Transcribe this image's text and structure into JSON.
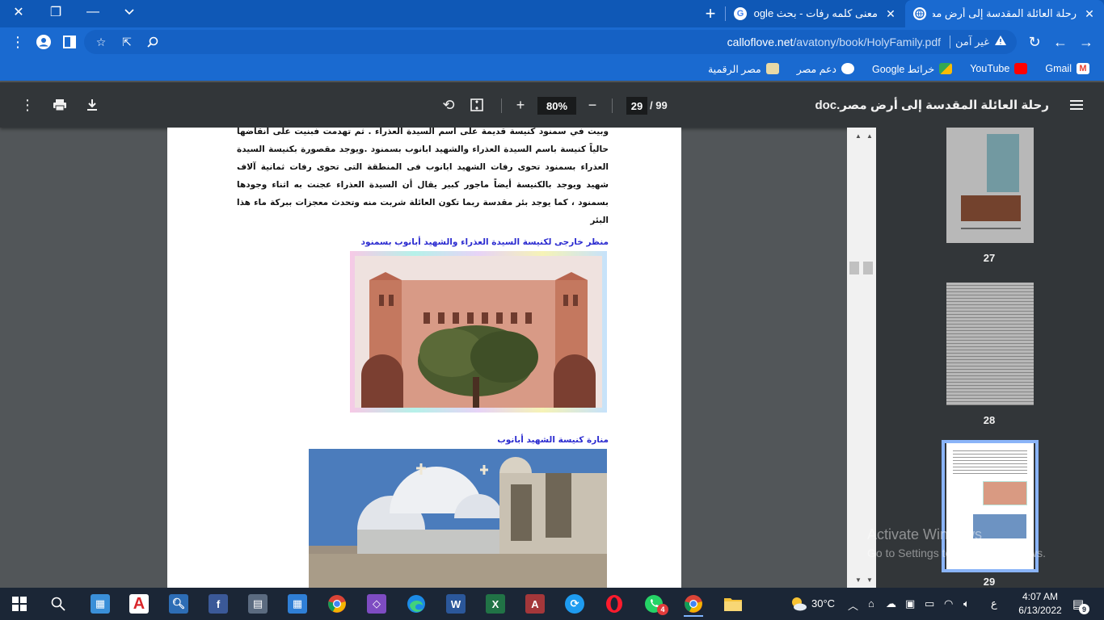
{
  "browser": {
    "tabs": [
      {
        "title": "رحلة العائلة المقدسة إلى أرض مصر",
        "favicon": "globe-icon",
        "active": true
      },
      {
        "title": "معنى كلمه رفات - بحث Google",
        "favicon": "google-icon",
        "active": false
      }
    ],
    "new_tab_label": "+",
    "address": {
      "insecure_label": "غير آمن",
      "domain": "calloflove.net",
      "path": "/avatony/book/HolyFamily.pdf"
    },
    "bookmarks": [
      {
        "label": "Gmail",
        "icon": "gmail-icon",
        "color": "#ea4335"
      },
      {
        "label": "YouTube",
        "icon": "youtube-icon",
        "color": "#ff0000"
      },
      {
        "label": "خرائط Google",
        "icon": "maps-icon",
        "color": "#34a853"
      },
      {
        "label": "دعم مصر",
        "icon": "globe-icon",
        "color": "#ffffff"
      },
      {
        "label": "مصر الرقمية",
        "icon": "digital-egypt-icon",
        "color": "#e8d9a6"
      }
    ]
  },
  "pdf": {
    "doc_title": "رحلة العائلة المقدسة إلى أرض مصر.doc",
    "current_page": "29",
    "total_pages": "/ 99",
    "zoom": "80%",
    "paragraph": "وبيت في سمنود كنيسة قديمة على اسم السيدة العذراء . ثم تهدمت فبنيت على أنقاضها حالياً كنيسة باسم السيدة العذراء والشهيد ابانوب بسمنود .ويوجد مقصورة بكنيسة السيدة العذراء بسمنود تحوى رفات الشهيد ابانوب فى المنطقة التى تحوى رفات ثمانية آلاف شهيد ويوجد بالكنيسة أيضاً ماجور كبير يقال أن السيدة العذراء عجنت به اثناء وجودها بسمنود ، كما يوجد بئر مقدسة ربما تكون العائلة شربت منه وتحدث معجزات ببركة ماء هذا البئر",
    "caption1": "منظر خارجى لكنيسة السيدة العذراء والشهيد أبانوب بسمنود",
    "caption2": "منارة كنيسة الشهيد أبانوب",
    "thumbnails": [
      {
        "number": "27"
      },
      {
        "number": "28"
      },
      {
        "number": "29"
      }
    ]
  },
  "watermark": {
    "line1": "Activate Windows",
    "line2": "Go to Settings to activate Windows."
  },
  "taskbar": {
    "apps": [
      {
        "name": "start",
        "icon": "windows-icon"
      },
      {
        "name": "search",
        "icon": "search-icon"
      },
      {
        "name": "app1",
        "icon": "control-panel-icon"
      },
      {
        "name": "acrobat",
        "icon": "acrobat-icon"
      },
      {
        "name": "magnifier",
        "icon": "magnifier-icon"
      },
      {
        "name": "facebook",
        "icon": "facebook-icon"
      },
      {
        "name": "calculator",
        "icon": "calculator-icon"
      },
      {
        "name": "calendar",
        "icon": "calendar-icon"
      },
      {
        "name": "chrome",
        "icon": "chrome-icon"
      },
      {
        "name": "visual-studio",
        "icon": "visual-studio-icon"
      },
      {
        "name": "edge",
        "icon": "edge-icon"
      },
      {
        "name": "word",
        "icon": "word-icon"
      },
      {
        "name": "excel",
        "icon": "excel-icon"
      },
      {
        "name": "access",
        "icon": "access-icon"
      },
      {
        "name": "sync",
        "icon": "sync-icon"
      },
      {
        "name": "opera",
        "icon": "opera-icon"
      },
      {
        "name": "whatsapp",
        "icon": "whatsapp-icon",
        "badge": "4"
      },
      {
        "name": "chrome-active",
        "icon": "chrome-icon"
      },
      {
        "name": "file-explorer",
        "icon": "folder-icon"
      }
    ],
    "weather": "30°C",
    "lang": "ع",
    "time": "4:07 AM",
    "date": "6/13/2022",
    "notifications": "9"
  }
}
